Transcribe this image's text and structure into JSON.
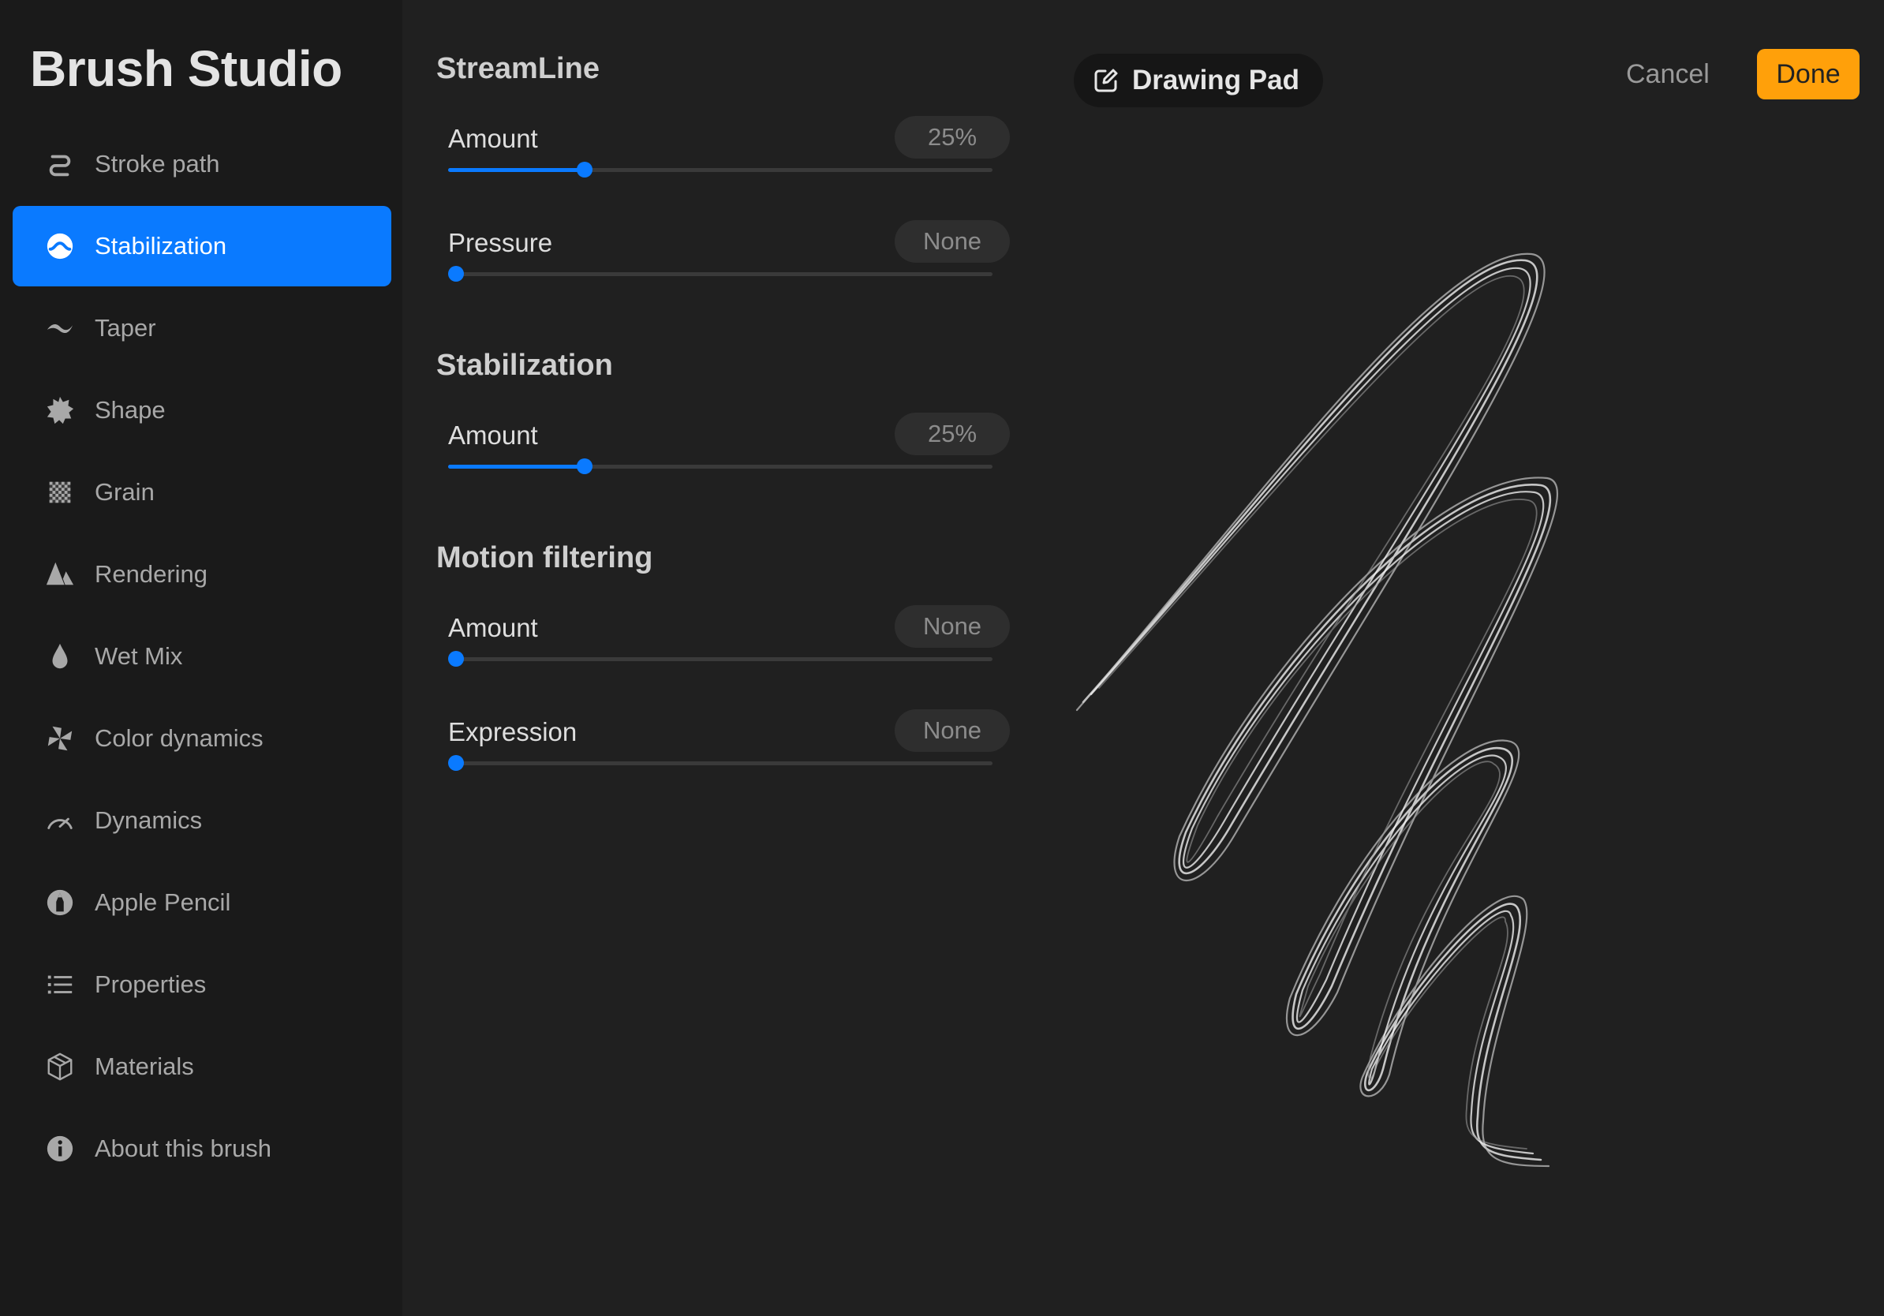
{
  "app_title": "Brush Studio",
  "sidebar": {
    "items": [
      {
        "label": "Stroke path",
        "icon": "stroke-path-icon",
        "active": false
      },
      {
        "label": "Stabilization",
        "icon": "stabilization-icon",
        "active": true
      },
      {
        "label": "Taper",
        "icon": "taper-icon",
        "active": false
      },
      {
        "label": "Shape",
        "icon": "shape-icon",
        "active": false
      },
      {
        "label": "Grain",
        "icon": "grain-icon",
        "active": false
      },
      {
        "label": "Rendering",
        "icon": "rendering-icon",
        "active": false
      },
      {
        "label": "Wet Mix",
        "icon": "wet-mix-icon",
        "active": false
      },
      {
        "label": "Color dynamics",
        "icon": "color-dynamics-icon",
        "active": false
      },
      {
        "label": "Dynamics",
        "icon": "dynamics-icon",
        "active": false
      },
      {
        "label": "Apple Pencil",
        "icon": "apple-pencil-icon",
        "active": false
      },
      {
        "label": "Properties",
        "icon": "properties-icon",
        "active": false
      },
      {
        "label": "Materials",
        "icon": "materials-icon",
        "active": false
      },
      {
        "label": "About this brush",
        "icon": "info-icon",
        "active": false
      }
    ]
  },
  "settings": {
    "streamline": {
      "title": "StreamLine",
      "amount": {
        "label": "Amount",
        "value_text": "25%",
        "value": 0.25
      },
      "pressure": {
        "label": "Pressure",
        "value_text": "None",
        "value": 0
      }
    },
    "stabilization": {
      "title": "Stabilization",
      "amount": {
        "label": "Amount",
        "value_text": "25%",
        "value": 0.25
      }
    },
    "motion_filtering": {
      "title": "Motion filtering",
      "amount": {
        "label": "Amount",
        "value_text": "None",
        "value": 0
      },
      "expression": {
        "label": "Expression",
        "value_text": "None",
        "value": 0
      }
    }
  },
  "pad": {
    "chip_label": "Drawing Pad",
    "cancel_label": "Cancel",
    "done_label": "Done"
  },
  "colors": {
    "accent": "#0a7aff",
    "done": "#ffa00a",
    "background": "#202020"
  }
}
